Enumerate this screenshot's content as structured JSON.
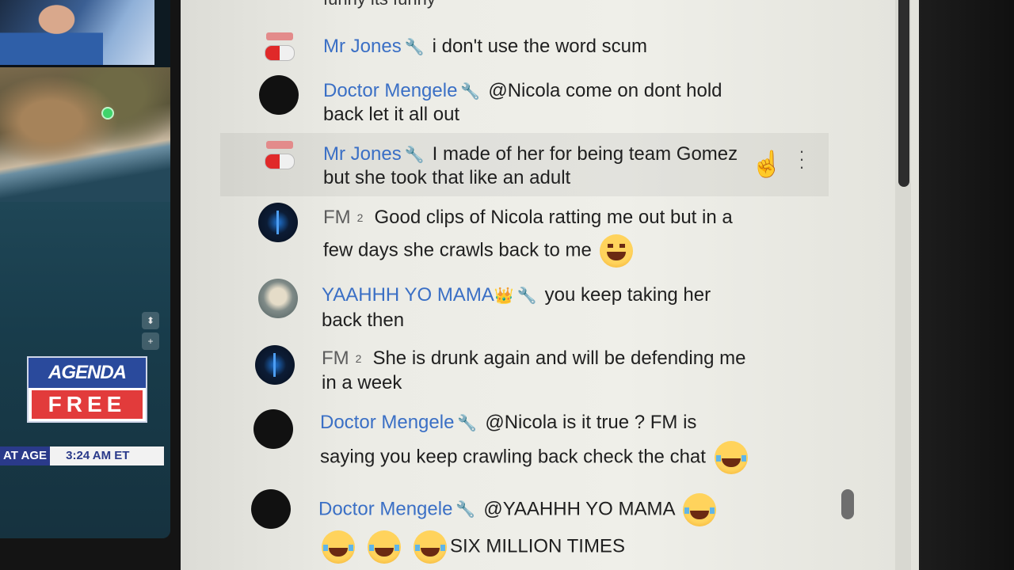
{
  "left_panel": {
    "logo_top": "AGENDA",
    "logo_bottom": "FREE",
    "ticker_left": "AT AGE",
    "ticker_time": "3:24 AM ET"
  },
  "chat": {
    "top_partial": "funny its funny",
    "messages": [
      {
        "author": "Mr Jones",
        "badge": "",
        "text1": "i don't use the word scum",
        "text2": ""
      },
      {
        "author": "Doctor Mengele",
        "badge": "",
        "text1": "@Nicola come on dont hold",
        "text2": "back let it all out"
      },
      {
        "author": "Mr Jones",
        "badge": "",
        "text1": "I made of her for being team Gomez",
        "text2": "but she took that like an adult"
      },
      {
        "author": "FM",
        "badge": "2",
        "text1": "Good clips of Nicola ratting me out but in a",
        "text2": "few days she crawls back to me"
      },
      {
        "author": "YAAHHH YO MAMA",
        "badge": "",
        "text1": "you keep taking her",
        "text2": "back then"
      },
      {
        "author": "FM",
        "badge": "2",
        "text1": "She is drunk again and will be defending me",
        "text2": "in a week"
      },
      {
        "author": "Doctor Mengele",
        "badge": "",
        "text1": "@Nicola is it true ? FM is",
        "text2": "saying you keep crawling back check the chat"
      },
      {
        "author": "Doctor Mengele",
        "badge": "",
        "text1": "@YAAHHH YO MAMA",
        "text2": "SIX MILLION TIMES"
      }
    ]
  },
  "icons": {
    "wrench": "wrench-icon",
    "more": "more-vert-icon",
    "cursor": "hand-cursor-icon"
  }
}
